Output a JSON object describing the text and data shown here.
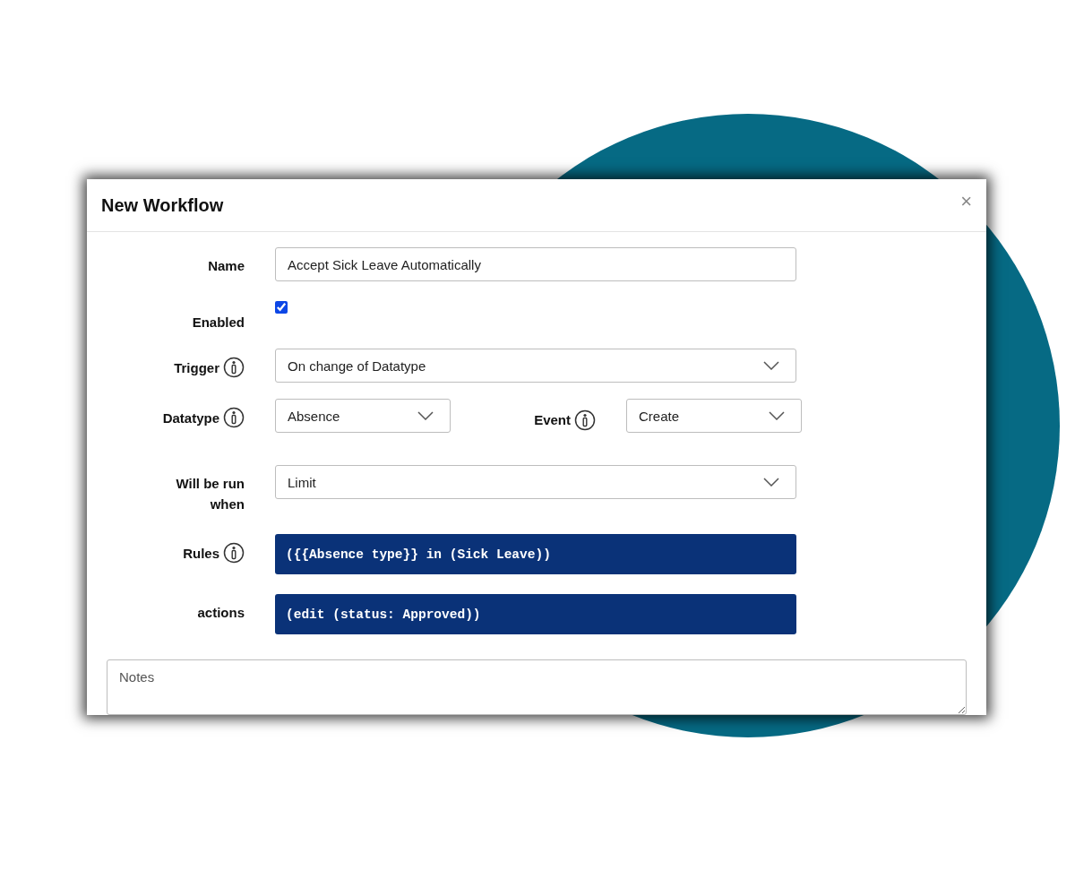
{
  "dialog": {
    "title": "New Workflow",
    "close": "×"
  },
  "fields": [
    {
      "kind": "text",
      "label": "Name",
      "info": false,
      "value": "Accept Sick Leave Automatically"
    },
    {
      "kind": "checkbox",
      "label": "Enabled",
      "info": false,
      "checked": true
    },
    {
      "kind": "select",
      "label": "Trigger",
      "info": true,
      "value": "On change of Datatype"
    },
    {
      "kind": "pair",
      "items": [
        {
          "label": "Datatype",
          "info": true,
          "value": "Absence"
        },
        {
          "label": "Event",
          "info": true,
          "value": "Create"
        }
      ]
    },
    {
      "kind": "select",
      "label": "Will be run when",
      "info": false,
      "value": "Limit"
    },
    {
      "kind": "code",
      "label": "Rules",
      "info": true,
      "value": "({{Absence type}} in (Sick Leave))"
    },
    {
      "kind": "code",
      "label": "actions",
      "info": false,
      "value": "(edit (status: Approved))"
    }
  ],
  "notes": {
    "placeholder": "Notes"
  }
}
